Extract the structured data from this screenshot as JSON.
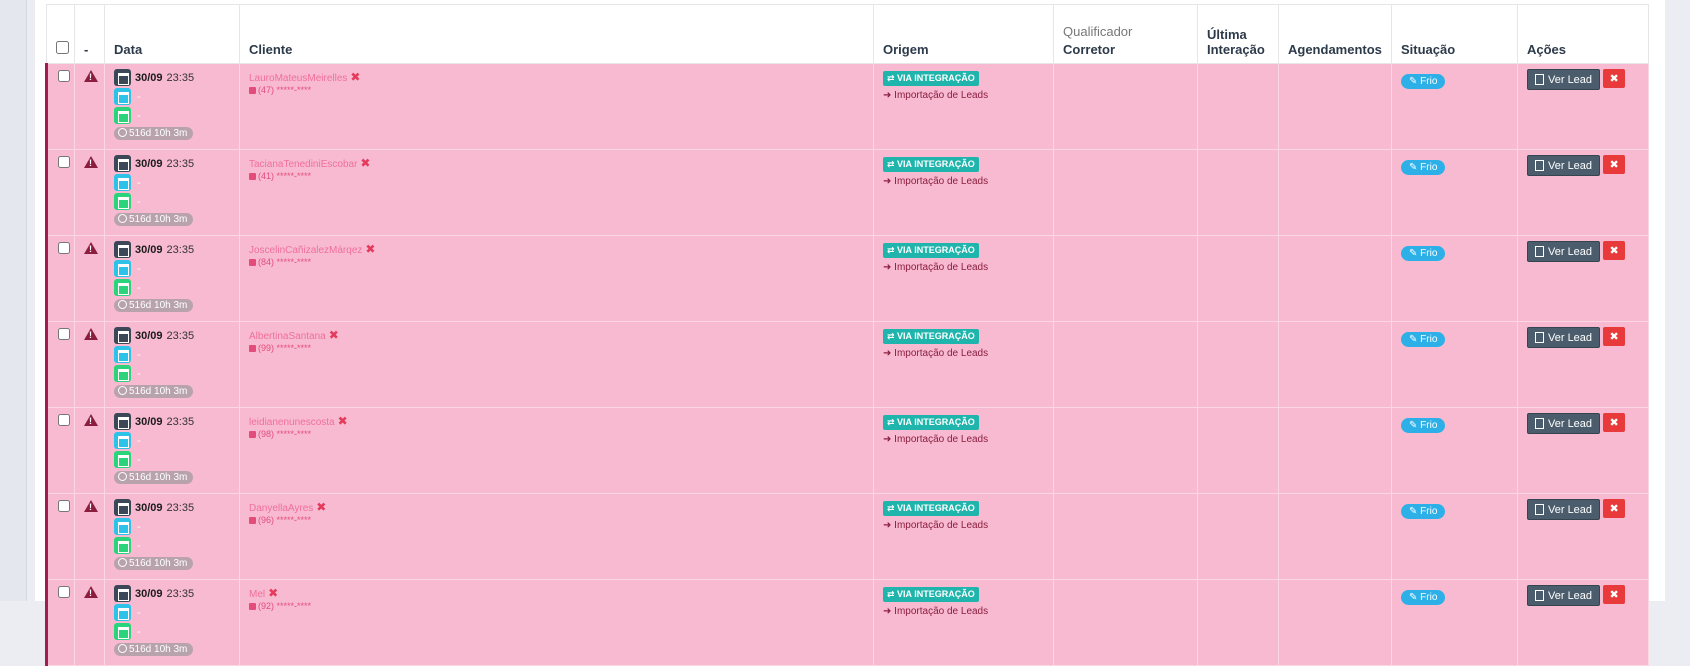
{
  "header": {
    "dash": "-",
    "data": "Data",
    "cliente": "Cliente",
    "origem": "Origem",
    "qualificador": "Qualificador",
    "corretor": "Corretor",
    "ultima_line1": "Última",
    "ultima_line2": "Interação",
    "agendamentos": "Agendamentos",
    "situacao": "Situação",
    "acoes": "Ações"
  },
  "colors": {
    "row_bg": "#f7bad0",
    "accent": "#8b1e3f",
    "via_badge": "#1fb5ac",
    "frio_badge": "#2db0e8",
    "delete": "#e83a3a"
  },
  "rows": [
    {
      "date": "30/09",
      "time": "23:35",
      "d2": "-",
      "d3": "-",
      "elapsed": "516d 10h 3m",
      "client": "LauroMateusMeirelles",
      "phone": "(47) *****-****",
      "via": "VIA INTEGRAÇÃO",
      "origem": "Importação de Leads",
      "situacao": "Frio",
      "ver_lead": "Ver Lead"
    },
    {
      "date": "30/09",
      "time": "23:35",
      "d2": "-",
      "d3": "-",
      "elapsed": "516d 10h 3m",
      "client": "TacianaTenediniEscobar",
      "phone": "(41) *****-****",
      "via": "VIA INTEGRAÇÃO",
      "origem": "Importação de Leads",
      "situacao": "Frio",
      "ver_lead": "Ver Lead"
    },
    {
      "date": "30/09",
      "time": "23:35",
      "d2": "-",
      "d3": "-",
      "elapsed": "516d 10h 3m",
      "client": "JoscelinCañizalezMárqez",
      "phone": "(84) *****-****",
      "via": "VIA INTEGRAÇÃO",
      "origem": "Importação de Leads",
      "situacao": "Frio",
      "ver_lead": "Ver Lead"
    },
    {
      "date": "30/09",
      "time": "23:35",
      "d2": "-",
      "d3": "-",
      "elapsed": "516d 10h 3m",
      "client": "AlbertinaSantana",
      "phone": "(99) *****-****",
      "via": "VIA INTEGRAÇÃO",
      "origem": "Importação de Leads",
      "situacao": "Frio",
      "ver_lead": "Ver Lead"
    },
    {
      "date": "30/09",
      "time": "23:35",
      "d2": "-",
      "d3": "-",
      "elapsed": "516d 10h 3m",
      "client": "leidianenunescosta",
      "phone": "(98) *****-****",
      "via": "VIA INTEGRAÇÃO",
      "origem": "Importação de Leads",
      "situacao": "Frio",
      "ver_lead": "Ver Lead"
    },
    {
      "date": "30/09",
      "time": "23:35",
      "d2": "-",
      "d3": "-",
      "elapsed": "516d 10h 3m",
      "client": "DanyellaAyres",
      "phone": "(96) *****-****",
      "via": "VIA INTEGRAÇÃO",
      "origem": "Importação de Leads",
      "situacao": "Frio",
      "ver_lead": "Ver Lead"
    },
    {
      "date": "30/09",
      "time": "23:35",
      "d2": "-",
      "d3": "-",
      "elapsed": "516d 10h 3m",
      "client": "Mel",
      "phone": "(92) *****-****",
      "via": "VIA INTEGRAÇÃO",
      "origem": "Importação de Leads",
      "situacao": "Frio",
      "ver_lead": "Ver Lead"
    }
  ]
}
